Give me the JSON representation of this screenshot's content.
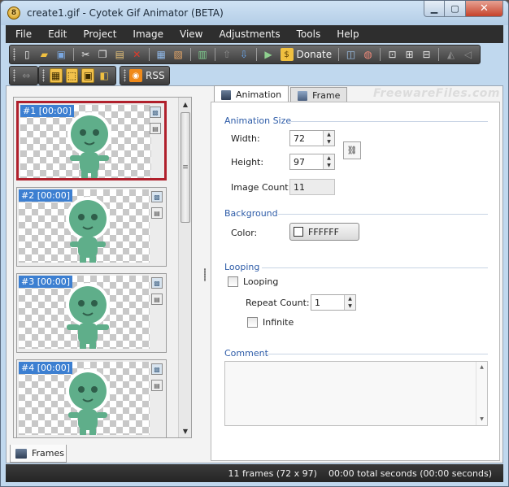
{
  "window": {
    "title": "create1.gif - Cyotek Gif Animator (BETA)"
  },
  "menu": [
    "File",
    "Edit",
    "Project",
    "Image",
    "View",
    "Adjustments",
    "Tools",
    "Help"
  ],
  "toolbar": {
    "donate_label": "Donate",
    "rss_label": "RSS"
  },
  "watermark": "FreewareFiles.com",
  "frames": [
    {
      "label": "#1 [00:00]",
      "selected": true
    },
    {
      "label": "#2 [00:00]",
      "selected": false
    },
    {
      "label": "#3 [00:00]",
      "selected": false
    },
    {
      "label": "#4 [00:00]",
      "selected": false
    }
  ],
  "frames_tab": "Frames",
  "tabs": [
    "Animation",
    "Frame"
  ],
  "animation": {
    "size_title": "Animation Size",
    "width_label": "Width:",
    "width_value": "72",
    "height_label": "Height:",
    "height_value": "97",
    "count_label": "Image Count:",
    "count_value": "11",
    "background_title": "Background",
    "color_label": "Color:",
    "color_value": "FFFFFF",
    "looping_title": "Looping",
    "looping_label": "Looping",
    "repeat_label": "Repeat Count:",
    "repeat_value": "1",
    "infinite_label": "Infinite",
    "comment_title": "Comment"
  },
  "status": {
    "frames": "11 frames (72 x 97)",
    "seconds": "00:00 total seconds (00:00 seconds)"
  },
  "colors": {
    "selection": "#b0202c",
    "accent": "#3c7fd1",
    "alien": "#5fae8a"
  }
}
